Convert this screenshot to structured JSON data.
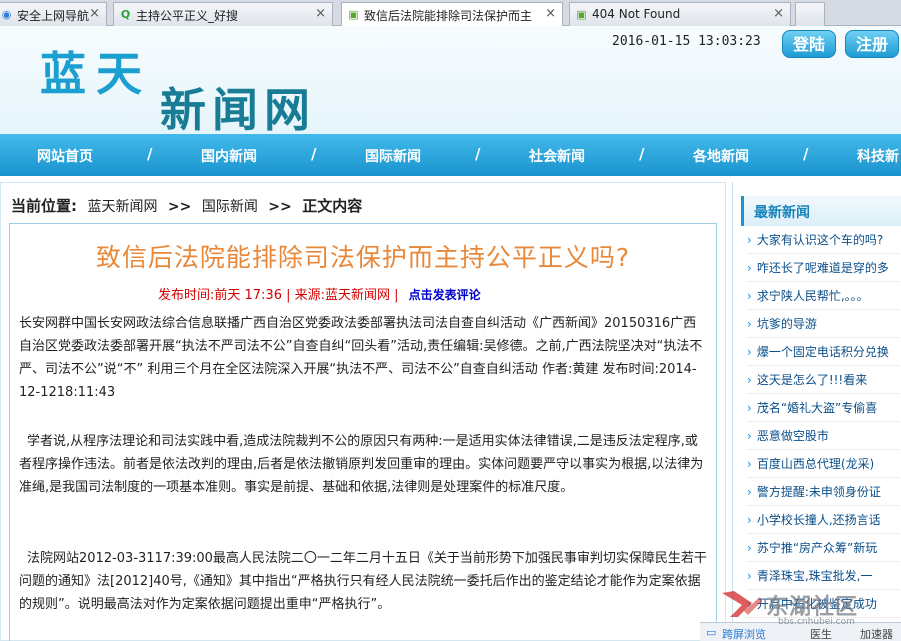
{
  "browser": {
    "tabs": [
      {
        "label": "安全上网导航",
        "icon": "globe-icon",
        "active": false
      },
      {
        "label": "主持公平正义_好搜",
        "icon": "search-q-icon",
        "active": false
      },
      {
        "label": "致信后法院能排除司法保护而主",
        "icon": "page-icon",
        "active": true
      },
      {
        "label": "404 Not Found",
        "icon": "page-icon",
        "active": false
      }
    ],
    "close_glyph": "×"
  },
  "header": {
    "logo_line1": "蓝天",
    "logo_line2": "新闻网",
    "datetime": "2016-01-15 13:03:23",
    "login_label": "登陆",
    "register_label": "注册"
  },
  "nav": {
    "items": [
      "网站首页",
      "国内新闻",
      "国际新闻",
      "社会新闻",
      "各地新闻",
      "科技新"
    ],
    "separator": "/"
  },
  "breadcrumb": {
    "prefix": "当前位置:",
    "items": [
      "蓝天新闻网",
      "国际新闻",
      "正文内容"
    ],
    "separator": ">>"
  },
  "article": {
    "title": "致信后法院能排除司法保护而主持公平正义吗?",
    "meta_text": "发布时间:前天 17:36 | 来源:蓝天新闻网 |",
    "comment_link": "点击发表评论",
    "paragraphs": [
      "长安网群中国长安网政法综合信息联播广西自治区党委政法委部署执法司法自查自纠活动《广西新闻》20150316广西自治区党委政法委部署开展“执法不严司法不公”自查自纠“回头看”活动,责任编辑:吴修德。之前,广西法院坚决对“执法不严、司法不公”说“不” 利用三个月在全区法院深入开展“执法不严、司法不公”自查自纠活动 作者:黄建 发布时间:2014-12-1218:11:43",
      "学者说,从程序法理论和司法实践中看,造成法院裁判不公的原因只有两种:一是适用实体法律错误,二是违反法定程序,或者程序操作违法。前者是依法改判的理由,后者是依法撤销原判发回重审的理由。实体问题要严守以事实为根据,以法律为准绳,是我国司法制度的一项基本准则。事实是前提、基础和依据,法律则是处理案件的标准尺度。",
      "法院网站2012-03-3117:39:00最高人民法院二〇一二年二月十五日《关于当前形势下加强民事审判切实保障民生若干问题的通知》法[2012]40号,《通知》其中指出“严格执行只有经人民法院统一委托后作出的鉴定结论才能作为定案依据的规则”。说明最高法对作为定案依据问题提出重申“严格执行”。"
    ]
  },
  "sidebar": {
    "heading": "最新新闻",
    "bullet": "›",
    "items": [
      "大家有认识这个车的吗?",
      "咋还长了呢难道是穿的多",
      "求宁陕人民帮忙,。。。",
      "坑爹的导游",
      "爆一个固定电话积分兑换",
      "这天是怎么了!!!看来",
      "茂名“婚礼大盗”专偷喜",
      "恶意做空股市",
      "百度山西总代理(龙采)",
      "警方提醒:未申领身份证",
      "小学校长撞人,还扬言话",
      "苏宁推“房产众筹”新玩",
      "青泽珠宝,珠宝批发,一",
      "开启中石化被鉴定成功"
    ]
  },
  "statusbar": {
    "item1": "跨屏浏览",
    "item2": "医生",
    "item3": "加速器"
  },
  "watermark": {
    "text": "东湖社区",
    "url": "bbs.cnhubei.com"
  }
}
